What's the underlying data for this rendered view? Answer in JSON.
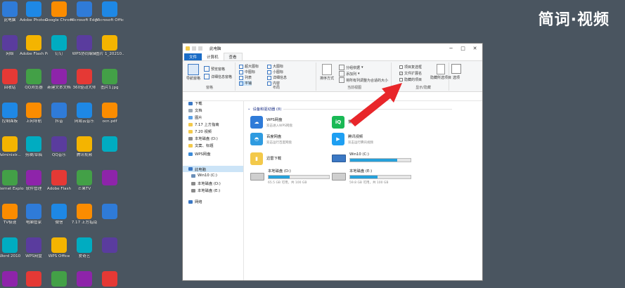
{
  "watermark": "简词·视频",
  "desktop": {
    "col1": [
      "此电脑",
      "网络",
      "回收站",
      "控制面板",
      "Administr...",
      "Internet Explorer",
      "TV极速",
      "Word 2010",
      ""
    ],
    "col2": [
      "Adobe Photosh...",
      "Adobe Flash Professio...",
      "QQ浏览器",
      "上网导航",
      "剪映/草稿",
      "软件管理",
      "电脑管家",
      "WPS网盘",
      ""
    ],
    "col3": [
      "Google Chrome",
      "钉钉",
      "新建文本文档",
      "抖音",
      "QQ音乐",
      "Adobe Flash",
      "微信",
      "WPS Office",
      ""
    ],
    "col4": [
      "Microsoft Edge",
      "WPS协同编辑",
      "360驱动大师",
      "网易云音乐",
      "腾讯视频",
      "芒果TV",
      "7.17 上方指南",
      "爱奇艺",
      ""
    ],
    "col5": [
      "Microsoft Office",
      "图片 1_20210...",
      "图片1.jpg",
      "ocn.pdf",
      "",
      "",
      "",
      "",
      ""
    ]
  },
  "window": {
    "title": "此电脑",
    "tabs": [
      "文件",
      "计算机",
      "查看"
    ],
    "ribbon": {
      "pane_group": {
        "label": "窗格",
        "nav_pane": "导航窗格",
        "preview": "预览窗格",
        "details": "详细信息窗格"
      },
      "layout_group": {
        "label": "布局",
        "items": [
          "超大图标",
          "大图标",
          "中图标",
          "小图标",
          "列表",
          "详细信息",
          "平铺",
          "内容"
        ]
      },
      "view_group": {
        "label": "当前视图",
        "sort": "排序方式",
        "group": "分组依据",
        "add_col": "添加列",
        "fit": "将所有列调整为合适的大小"
      },
      "show_group": {
        "label": "显示/隐藏",
        "item_chk": "项目复选框",
        "ext": "文件扩展名",
        "hidden": "隐藏的项目",
        "hide_sel": "隐藏所选项目"
      },
      "options": "选项"
    },
    "nav": [
      "下载",
      "文档",
      "图片",
      "7.17 上方指南",
      "7.20 视频",
      "本地磁盘 (D:)",
      "文案、标题",
      "WPS网盘",
      "此电脑",
      "Win10 (C:)",
      "本地磁盘 (D:)",
      "本地磁盘 (E:)",
      "网络"
    ],
    "section_header": "设备和驱动器 (8)",
    "tiles": [
      {
        "name": "WPS网盘",
        "sub": "双击进入WPS网盘"
      },
      {
        "name": "百度网盘",
        "sub": "双击运行百度网盘"
      },
      {
        "name": "迅雷下载",
        "sub": ""
      },
      {
        "name": "爱奇艺",
        "sub": ""
      },
      {
        "name": "腾讯视频",
        "sub": "双击运行腾讯视频"
      }
    ],
    "drives": [
      {
        "name": "本地磁盘 (D:)",
        "free": "65.5 GB 可用，共 100 GB",
        "used": 0.35
      },
      {
        "name": "Win10 (C:)",
        "free": "",
        "used": 0.78
      },
      {
        "name": "本地磁盘 (E:)",
        "free": "59.8 GB 可用，共 100 GB",
        "used": 0.45
      }
    ]
  }
}
